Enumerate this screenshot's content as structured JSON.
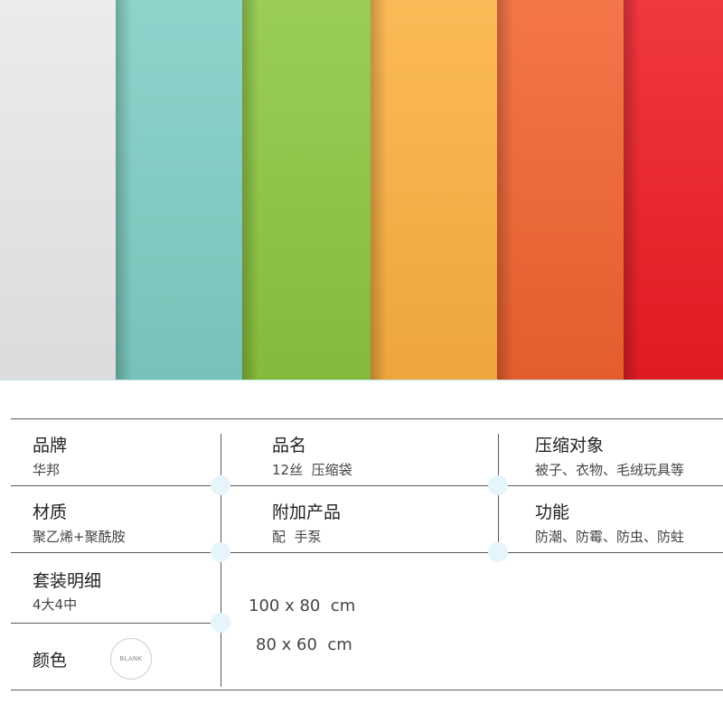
{
  "swatches": [
    {
      "name": "white",
      "color": "#e9e9ea"
    },
    {
      "name": "teal",
      "color": "#7ecec4"
    },
    {
      "name": "green",
      "color": "#8cc63f"
    },
    {
      "name": "orange",
      "color": "#fbb040"
    },
    {
      "name": "orange-red",
      "color": "#f26330"
    },
    {
      "name": "red",
      "color": "#ee1c25"
    }
  ],
  "specs": {
    "brand": {
      "label": "品牌",
      "value": "华邦"
    },
    "product_name": {
      "label": "品名",
      "value": "12丝  压缩袋"
    },
    "compress_target": {
      "label": "压缩对象",
      "value": "被子、衣物、毛绒玩具等"
    },
    "material": {
      "label": "材质",
      "value": "聚乙烯+聚酰胺"
    },
    "accessory": {
      "label": "附加产品",
      "value": "配  手泵"
    },
    "function": {
      "label": "功能",
      "value": "防潮、防霉、防虫、防蛀"
    },
    "set_detail": {
      "label": "套装明细",
      "value": "4大4中"
    },
    "sizes": [
      "100 x 80  cm",
      "80 x 60  cm"
    ],
    "color": {
      "label": "颜色",
      "badge": "BLANK"
    }
  }
}
